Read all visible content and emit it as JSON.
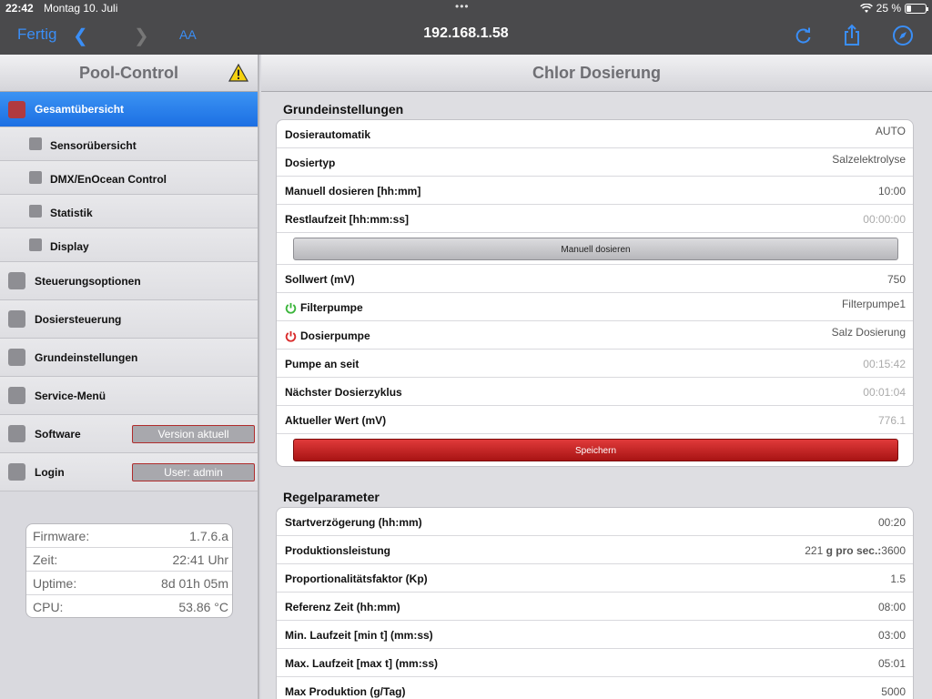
{
  "status_bar": {
    "time": "22:42",
    "date": "Montag 10. Juli",
    "battery": "25 %"
  },
  "browser": {
    "done_label": "Fertig",
    "text_size_label": "AA",
    "url": "192.168.1.58"
  },
  "sidebar": {
    "title": "Pool-Control",
    "items": [
      {
        "label": "Gesamtübersicht"
      },
      {
        "label": "Sensorübersicht"
      },
      {
        "label": "DMX/EnOcean Control"
      },
      {
        "label": "Statistik"
      },
      {
        "label": "Display"
      },
      {
        "label": "Steuerungsoptionen"
      },
      {
        "label": "Dosiersteuerung"
      },
      {
        "label": "Grundeinstellungen"
      },
      {
        "label": "Service-Menü"
      },
      {
        "label": "Software",
        "badge": "Version aktuell"
      },
      {
        "label": "Login",
        "badge": "User: admin"
      }
    ],
    "info": [
      {
        "key": "Firmware:",
        "value": "1.7.6.a"
      },
      {
        "key": "Zeit:",
        "value": "22:41 Uhr"
      },
      {
        "key": "Uptime:",
        "value": "8d 01h 05m"
      },
      {
        "key": "CPU:",
        "value": "53.86 °C"
      }
    ]
  },
  "main": {
    "title": "Chlor Dosierung",
    "grund": {
      "title": "Grundeinstellungen",
      "dosierautomatik": {
        "label": "Dosierautomatik",
        "value": "AUTO"
      },
      "dosiertyp": {
        "label": "Dosiertyp",
        "value": "Salzelektrolyse"
      },
      "manuell": {
        "label": "Manuell dosieren [hh:mm]",
        "value": "10:00"
      },
      "restlaufzeit": {
        "label": "Restlaufzeit [hh:mm:ss]",
        "value": "00:00:00"
      },
      "manuell_button": "Manuell dosieren",
      "sollwert": {
        "label": "Sollwert (mV)",
        "value": "750"
      },
      "filterpumpe": {
        "label": "Filterpumpe",
        "value": "Filterpumpe1"
      },
      "dosierpumpe": {
        "label": "Dosierpumpe",
        "value": "Salz Dosierung"
      },
      "pumpe_an": {
        "label": "Pumpe an seit",
        "value": "00:15:42"
      },
      "naechster": {
        "label": "Nächster Dosierzyklus",
        "value": "00:01:04"
      },
      "aktuell": {
        "label": "Aktueller Wert (mV)",
        "value": "776.1"
      },
      "save_button": "Speichern"
    },
    "regel": {
      "title": "Regelparameter",
      "startverz": {
        "label": "Startverzögerung (hh:mm)",
        "value": "00:20"
      },
      "produktion": {
        "label": "Produktionsleistung",
        "value": "221",
        "unit": "g pro sec.:",
        "value2": "3600"
      },
      "kp": {
        "label": "Proportionalitätsfaktor (Kp)",
        "value": "1.5"
      },
      "referenz": {
        "label": "Referenz Zeit (hh:mm)",
        "value": "08:00"
      },
      "min_lauf": {
        "label": "Min. Laufzeit [min t] (mm:ss)",
        "value": "03:00"
      },
      "max_lauf": {
        "label": "Max. Laufzeit [max t] (mm:ss)",
        "value": "05:01"
      },
      "max_prod": {
        "label": "Max Produktion (g/Tag)",
        "value": "5000"
      }
    }
  },
  "colors": {
    "accent": "#1c6fe3",
    "active_square": "#b13a3f",
    "save": "#c02020",
    "power_on": "#3bb53b",
    "power_off": "#d92b2b"
  }
}
